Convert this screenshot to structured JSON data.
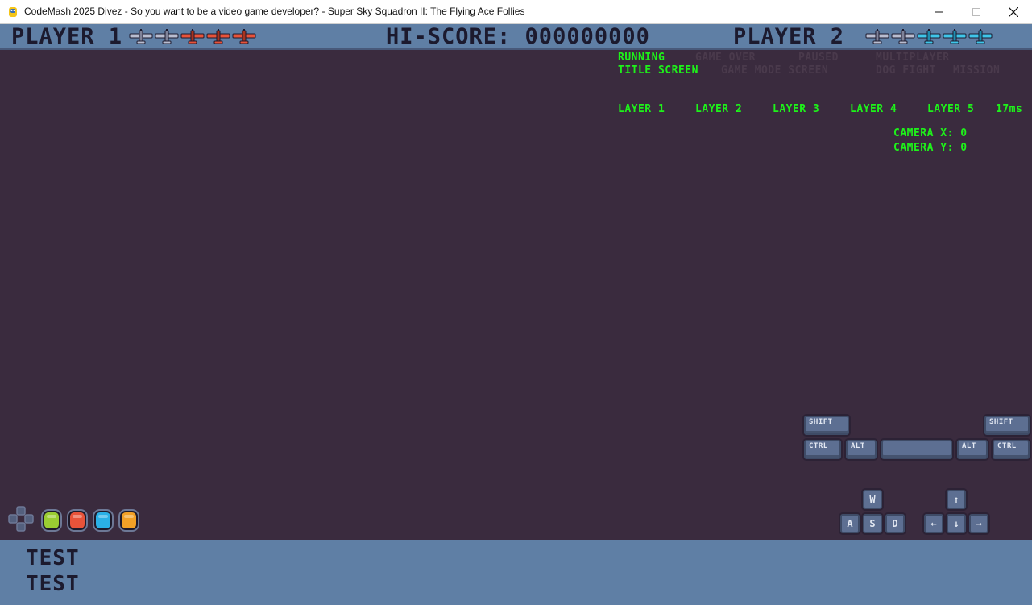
{
  "window": {
    "title": "CodeMash 2025 Divez - So you want to be a video game developer? - Super Sky Squadron II: The Flying Ace Follies"
  },
  "hud": {
    "player1_label": "PLAYER 1",
    "hiscore_label": "HI-SCORE: 000000000",
    "player2_label": "PLAYER 2",
    "player1_lives": [
      "grey",
      "grey",
      "orange",
      "orange",
      "orange"
    ],
    "player2_lives": [
      "grey",
      "grey",
      "cyan",
      "cyan",
      "cyan"
    ]
  },
  "debug": {
    "states": {
      "running": "RUNNING",
      "game_over": "GAME OVER",
      "paused": "PAUSED",
      "multiplayer": "MULTIPLAYER",
      "title_screen": "TITLE SCREEN",
      "game_mode_screen": "GAME MODE SCREEN",
      "dog_fight": "DOG FIGHT",
      "mission": "MISSION"
    },
    "layers": [
      "LAYER 1",
      "LAYER 2",
      "LAYER 3",
      "LAYER 4",
      "LAYER 5"
    ],
    "frame_time": "17ms",
    "camera_x": "CAMERA X: 0",
    "camera_y": "CAMERA Y: 0"
  },
  "keyboard": {
    "shift_left": "SHIFT",
    "shift_right": "SHIFT",
    "ctrl_left": "CTRL",
    "alt_left": "ALT",
    "alt_right": "ALT",
    "ctrl_right": "CTRL",
    "w": "W",
    "a": "A",
    "s": "S",
    "d": "D",
    "arrow_up": "↑",
    "arrow_left": "←",
    "arrow_down": "↓",
    "arrow_right": "→"
  },
  "gamepad": {
    "buttons": [
      "#9acd32",
      "#e8533a",
      "#2ab0e6",
      "#f2a127"
    ]
  },
  "bottom": {
    "line1": "TEST",
    "line2": "TEST"
  },
  "colors": {
    "background": "#3a2b3e",
    "hud": "#5f7fa5",
    "debug_active": "#1ef21a",
    "debug_inactive": "#4a3a4c"
  }
}
